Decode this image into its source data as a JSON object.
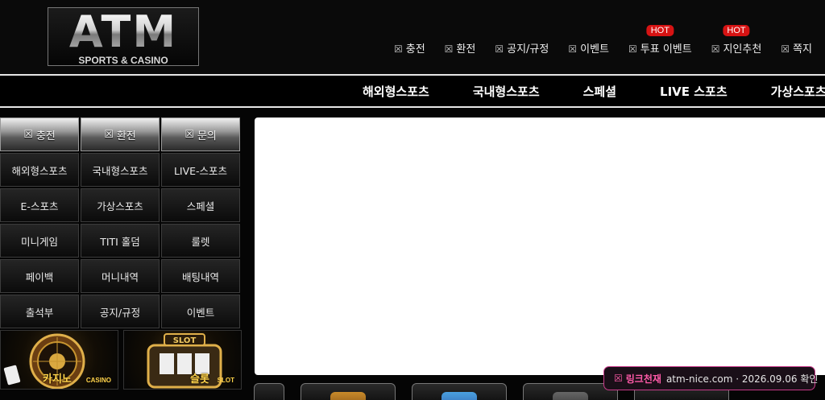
{
  "logo": {
    "title": "ATM",
    "subtitle": "SPORTS & CASINO"
  },
  "topnav": [
    {
      "label": "충전",
      "icon": "box-icon",
      "hot": ""
    },
    {
      "label": "환전",
      "icon": "box-icon",
      "hot": ""
    },
    {
      "label": "공지/규정",
      "icon": "box-icon",
      "hot": ""
    },
    {
      "label": "이벤트",
      "icon": "box-icon",
      "hot": ""
    },
    {
      "label": "투표 이벤트",
      "icon": "box-icon",
      "hot": "HOT"
    },
    {
      "label": "지인추천",
      "icon": "box-icon",
      "hot": "HOT"
    },
    {
      "label": "쪽지",
      "icon": "box-icon",
      "hot": ""
    }
  ],
  "icon_glyph": "☒",
  "mainnav": [
    "해외형스포츠",
    "국내형스포츠",
    "스페셜",
    "LIVE 스포츠",
    "가상스포츠"
  ],
  "quick": [
    "충전",
    "환전",
    "문의"
  ],
  "grid": [
    "해외형스포츠",
    "국내형스포츠",
    "LIVE-스포츠",
    "E-스포츠",
    "가상스포츠",
    "스페셜",
    "미니게임",
    "TITI 홀덤",
    "룰렛",
    "페이백",
    "머니내역",
    "배팅내역",
    "출석부",
    "공지/규정",
    "이벤트"
  ],
  "banners": [
    {
      "label": "카지노",
      "sub": "CASINO"
    },
    {
      "label": "슬롯",
      "sub": "SLOT"
    }
  ],
  "toast": {
    "brand": "링크천재",
    "msg": "atm-nice.com · 2026.09.06 확인"
  },
  "colors": {
    "hot": "#d61313",
    "toast_accent": "#ff5aa8",
    "background": "#050505"
  }
}
